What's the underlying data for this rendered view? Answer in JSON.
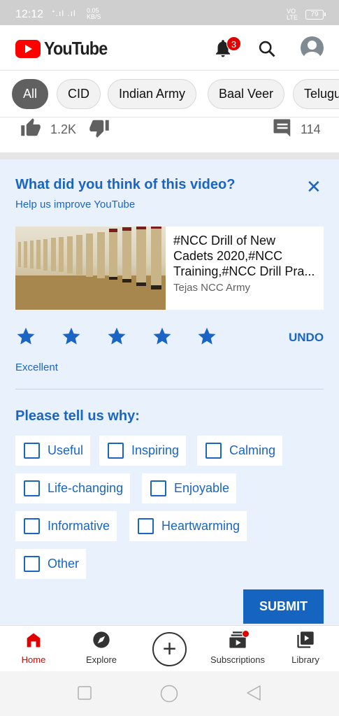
{
  "statusbar": {
    "time": "12:12",
    "signal": "ᐩ.ıl .ıl",
    "netspeed_value": "0.05",
    "netspeed_unit": "KB/S",
    "network_top": "VO",
    "network_bottom": "LTE",
    "battery": "79"
  },
  "header": {
    "brand": "YouTube",
    "notification_count": "3"
  },
  "chips": [
    "All",
    "CID",
    "Indian Army",
    "Baal Veer",
    "Telugu"
  ],
  "video_actions": {
    "like_count": "1.2K",
    "comment_count": "114"
  },
  "survey": {
    "question": "What did you think of this video?",
    "subtitle": "Help us improve YouTube",
    "video_title": "#NCC Drill of New Cadets 2020,#NCC Training,#NCC Drill Pra...",
    "channel": "Tejas NCC Army",
    "rating_stars": 5,
    "undo_label": "UNDO",
    "rating_label": "Excellent",
    "why_heading": "Please tell us why:",
    "options": [
      "Useful",
      "Inspiring",
      "Calming",
      "Life-changing",
      "Enjoyable",
      "Informative",
      "Heartwarming",
      "Other"
    ],
    "submit_label": "SUBMIT"
  },
  "bottom_nav": {
    "home": "Home",
    "explore": "Explore",
    "create": "+",
    "subscriptions": "Subscriptions",
    "library": "Library"
  },
  "colors": {
    "accent_blue": "#1a64c4",
    "youtube_red": "#ff0000",
    "survey_bg": "#e9f2fc"
  }
}
